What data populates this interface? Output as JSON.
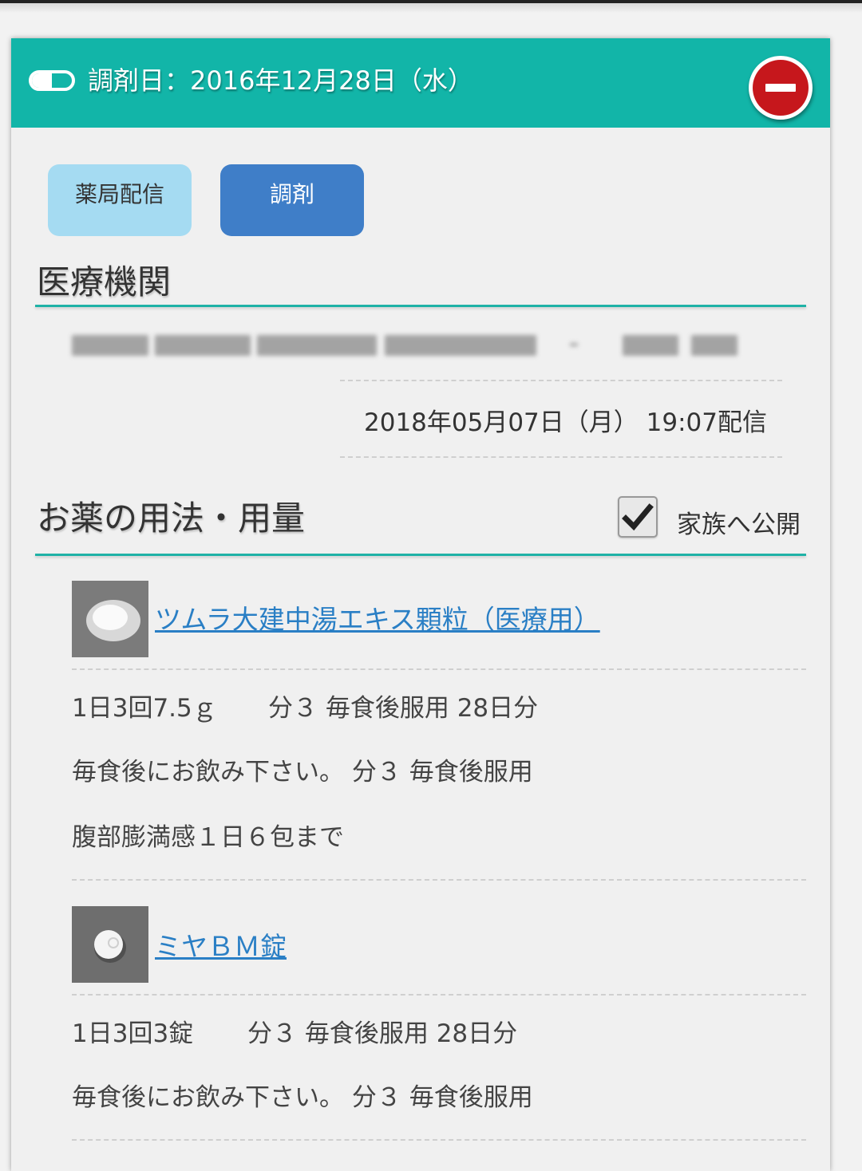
{
  "header": {
    "title": "調剤日：2016年12月28日（水）",
    "pill_icon": "pill-icon",
    "close_icon": "minus-circle-icon"
  },
  "tabs": {
    "pharmacy_label": "薬局配信",
    "dispense_label": "調剤"
  },
  "institution": {
    "heading": "医療機関",
    "delivered_at": "2018年05月07日（月） 19:07配信"
  },
  "usage": {
    "heading": "お薬の用法・用量",
    "share_label": "家族へ公開",
    "share_checked": true
  },
  "medicines": [
    {
      "name": "ツムラ大建中湯エキス顆粒（医療用）",
      "dosage": "1日3回7.5ｇ",
      "timing": "分３ 毎食後服用 28日分",
      "instruction": "毎食後にお飲み下さい。 分３ 毎食後服用",
      "note": "腹部膨満感１日６包まで"
    },
    {
      "name": "ミヤＢＭ錠",
      "dosage": "1日3回3錠",
      "timing": "分３ 毎食後服用 28日分",
      "instruction": "毎食後にお飲み下さい。 分３ 毎食後服用"
    }
  ],
  "colors": {
    "header": "#12b5a8",
    "accent_rule": "#1fb2a6",
    "tab_pharmacy": "#a5dbf2",
    "tab_dispense": "#3f7ec8",
    "link": "#2a7fc5",
    "close": "#c6171c"
  }
}
